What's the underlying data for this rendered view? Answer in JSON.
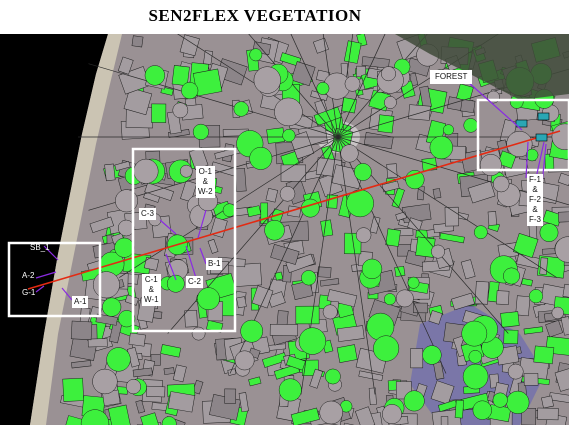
{
  "title": "SEN2FLEX VEGETATION",
  "colors": {
    "sea": "#000000",
    "coast": "#c8c0b0",
    "land": "#9a9194",
    "vegetation": "#3df03d",
    "field_lines": "#1e1e1e",
    "transect": "#e32a12",
    "box": "#ffffff",
    "pointer": "#8a2be2",
    "site_marker": "#2aa6b4"
  },
  "labels": {
    "forest": "FOREST",
    "sb1": "SB_1",
    "a2": "A-2",
    "g1": "G-1",
    "a1": "A-1",
    "c3": "C-3",
    "o1_w2": "O-1\n&\nW-2",
    "b1": "B-1",
    "c1_w1": "C-1\n&\nW-1",
    "c2": "C-2",
    "f_sites": "F-1\n&\nF-2\n&\nF-3"
  },
  "site_boxes": [
    "west-site-box",
    "central-site-box",
    "forest-site-box"
  ]
}
